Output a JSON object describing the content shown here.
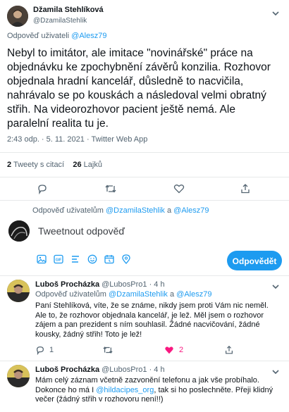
{
  "tweet": {
    "author_name": "Džamila Stehlíková",
    "author_handle": "@DzamilaStehlik",
    "reply_prefix": "Odpověď uživateli",
    "reply_to": "@Alesz79",
    "text": "Nebyl to imitátor, ale imitace \"novinářské\" práce na objednávku ke zpochybnění závěrů konzilia. Rozhovor objednala hradní kancelář, důsledně to nacvičila, nahrávalo se po kouskách a následoval velmi obratný střih. Na videorozhovor pacient ještě nemá. Ale paralelní realita tu je.",
    "meta": "2:43 odp. · 5. 11. 2021 · Twitter Web App",
    "stats": {
      "retweets_count": "2",
      "retweets_label": "Tweety s citací",
      "likes_count": "26",
      "likes_label": "Lajků"
    }
  },
  "composer": {
    "reply_prefix": "Odpověď uživatelům",
    "reply_to_1": "@DzamilaStehlik",
    "reply_and": "a",
    "reply_to_2": "@Alesz79",
    "placeholder": "Tweetnout odpověď",
    "reply_button": "Odpovědět"
  },
  "replies": [
    {
      "author_name": "Luboš Procházka",
      "author_handle": "@LubosPro1",
      "time": "· 4 h",
      "reply_prefix": "Odpověď uživatelům",
      "reply_to_1": "@DzamilaStehlik",
      "reply_and": "a",
      "reply_to_2": "@Alesz79",
      "text": "Paní Stehlíková, víte, že se známe, nikdy jsem proti Vám nic neměl. Ale to, že rozhovor objednala kancelář, je lež. Měl jsem o rozhovor zájem a pan prezident s ním souhlasil. Žádné nacvičování, žádné kousky, žádný střih! Toto je lež!",
      "reply_count": "1",
      "like_count": "2"
    },
    {
      "author_name": "Luboš Procházka",
      "author_handle": "@LubosPro1",
      "time": "· 4 h",
      "text_a": "Mám celý záznam včetně zazvonění telefonu a jak vše probíhalo. Dokonce ho má I",
      "mention": "@hildacipes_org",
      "text_b": ", tak si ho poslechněte. Přeji klidný večer (žádný střih v rozhovoru není!!)"
    }
  ],
  "colors": {
    "accent": "#1d9bf0",
    "like": "#f91880",
    "muted": "#536471",
    "divider": "#e7e9ea"
  },
  "icons": [
    "chevron-down-icon",
    "reply-icon",
    "retweet-icon",
    "like-icon",
    "share-icon",
    "image-icon",
    "gif-icon",
    "poll-icon",
    "emoji-icon",
    "schedule-icon",
    "location-icon",
    "more-icon"
  ]
}
